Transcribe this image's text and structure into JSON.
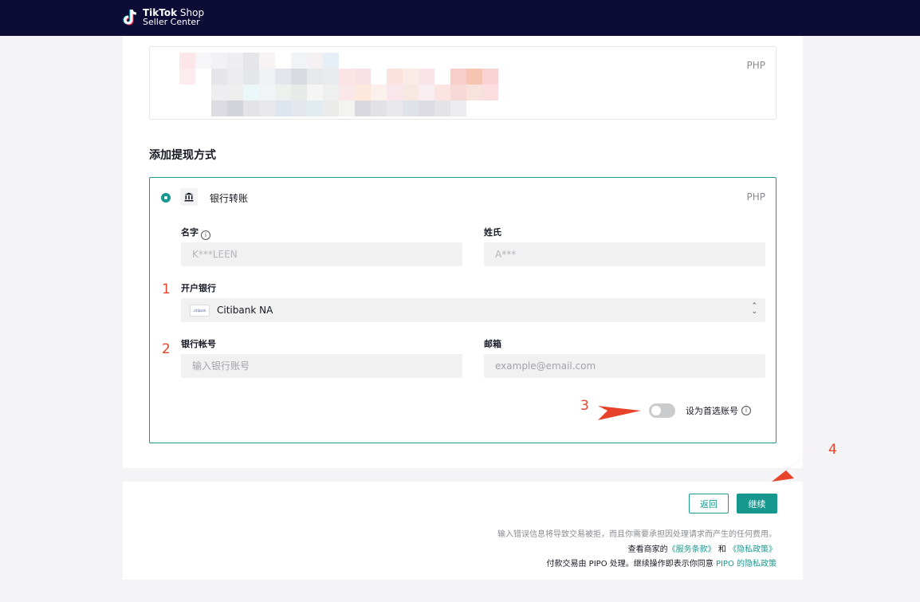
{
  "header": {
    "brand_line1_bold": "TikTok",
    "brand_line1_rest": " Shop",
    "brand_line2": "Seller Center",
    "logo_icon": "tiktok-logo-icon"
  },
  "balance": {
    "currency": "PHP"
  },
  "section_title": "添加提现方式",
  "method": {
    "icon": "bank-icon",
    "label": "银行转账",
    "currency": "PHP",
    "first_name_label": "名字",
    "first_name_value": "K***LEEN",
    "last_name_label": "姓氏",
    "last_name_value": "A***",
    "bank_label": "开户银行",
    "bank_logo_text": "citibank",
    "bank_value": "Citibank NA",
    "account_label": "银行帐号",
    "account_placeholder": "输入银行账号",
    "email_label": "邮箱",
    "email_placeholder": "example@email.com",
    "default_toggle_label": "设为首选账号",
    "default_toggle_on": false
  },
  "annotations": [
    "1",
    "2",
    "3",
    "4"
  ],
  "annotation_color": "#e8432a",
  "accent_color": "#17988f",
  "actions": {
    "back_label": "返回",
    "continue_label": "继续"
  },
  "footer": {
    "warning": "输入错误信息将导致交易被拒，而且你需要承担因处理请求而产生的任何费用。",
    "terms_prefix": "查看商家的",
    "terms_link": "《服务条款》",
    "terms_and": "和",
    "privacy_link": "《隐私政策》",
    "pipo_prefix": "付款交易由 PIPO 处理。继续操作即表示你同意",
    "pipo_link": "PIPO 的隐私政策"
  }
}
